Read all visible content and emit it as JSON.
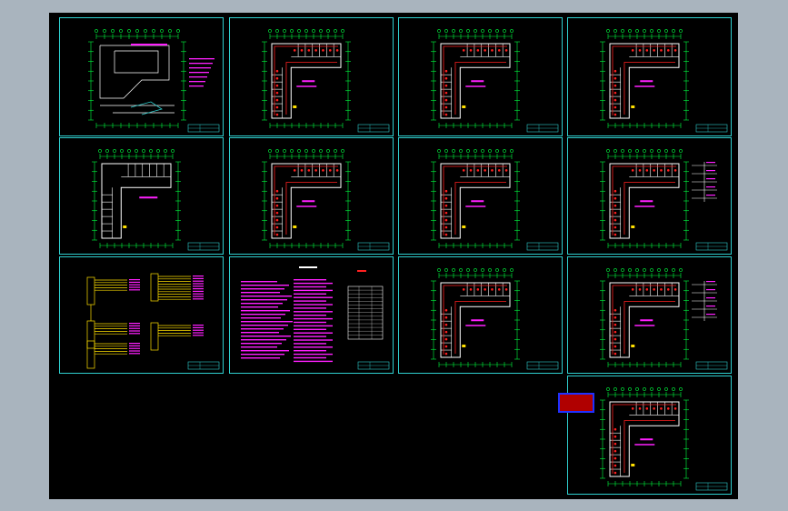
{
  "colors": {
    "background": "#a9b4be",
    "canvas": "#000000",
    "frame": "#2fd0d0",
    "dimension": "#00ff40",
    "wall": "#ffffff",
    "wiring": "#ff2020",
    "annotation": "#ff20ff",
    "stamp_border": "#2030ff",
    "stamp_fill": "#b00000",
    "stamp_text": "#ffd000"
  },
  "sheets": [
    {
      "id": "s1",
      "kind": "site-plan"
    },
    {
      "id": "s2",
      "kind": "floor-plan-wired"
    },
    {
      "id": "s3",
      "kind": "floor-plan-wired"
    },
    {
      "id": "s4",
      "kind": "floor-plan-wired"
    },
    {
      "id": "s5",
      "kind": "floor-plan-ground"
    },
    {
      "id": "s6",
      "kind": "floor-plan-wired"
    },
    {
      "id": "s7",
      "kind": "floor-plan-wired"
    },
    {
      "id": "s8",
      "kind": "floor-plan-riser"
    },
    {
      "id": "s9",
      "kind": "system-diagram"
    },
    {
      "id": "s10",
      "kind": "design-notes"
    },
    {
      "id": "s11",
      "kind": "floor-plan-wired"
    },
    {
      "id": "s12",
      "kind": "floor-plan-riser"
    },
    {
      "id": "s13",
      "kind": "floor-plan-wired"
    }
  ],
  "stamp": {
    "line1": "",
    "line2": ""
  },
  "icons": {
    "drawing": "cad-drawing-icon",
    "stamp": "stamp-icon"
  }
}
